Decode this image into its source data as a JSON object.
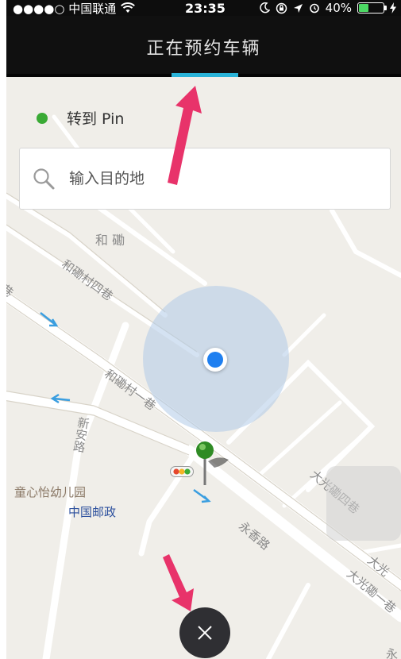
{
  "status_bar": {
    "carrier": "●●●●○ 中国联通",
    "time": "23:35",
    "battery": "40%",
    "battery_level": 0.4
  },
  "header": {
    "title": "正在预约车辆"
  },
  "pin_row": {
    "label": "转到 Pin"
  },
  "search": {
    "placeholder": "输入目的地"
  },
  "map_labels": {
    "area": "和 磡",
    "road_1": "和磡村四巷",
    "road_2": "和磡村一巷",
    "road_3": "新安路",
    "road_4": "永香路",
    "road_5": "大光磡四巷",
    "road_6": "大光磡一巷",
    "road_7": "大光",
    "poi_1": "童心怡幼儿园",
    "poi_2": "中国邮政",
    "edge_1": "巷",
    "edge_2": "永"
  },
  "icons": {
    "search": "search-icon",
    "close": "close-icon",
    "pin": "map-pin-icon",
    "wifi": "wifi-icon",
    "battery": "battery-icon",
    "traffic": "traffic-light-icon"
  },
  "colors": {
    "accent": "#29b3d8",
    "pin_dot": "#3aaa35",
    "location": "#1e7ff0",
    "annotation_arrow": "#e8336a"
  }
}
